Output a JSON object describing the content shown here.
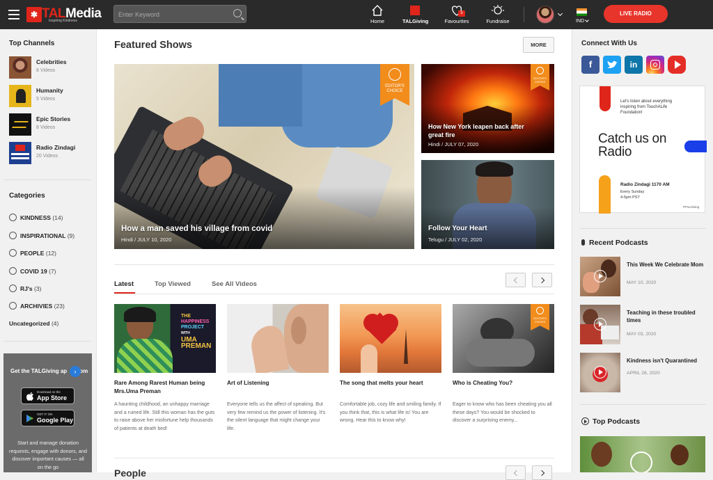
{
  "header": {
    "logo_text_a": "TAL",
    "logo_text_b": "Media",
    "logo_tagline": "Inspiring Kindness",
    "search_placeholder": "Enter Keyword",
    "nav": [
      {
        "label": "Home",
        "icon": "home-icon"
      },
      {
        "label": "TALGiving",
        "icon": "talgiving-icon"
      },
      {
        "label": "Favourites",
        "icon": "heart-icon",
        "badge": "5"
      },
      {
        "label": "Fundraise",
        "icon": "fundraise-icon"
      }
    ],
    "country": "IND",
    "live_radio": "LIVE RADIO"
  },
  "left": {
    "top_channels_title": "Top Channels",
    "channels": [
      {
        "name": "Celebrities",
        "count": "8 Videos"
      },
      {
        "name": "Humanity",
        "count": "5 Videos"
      },
      {
        "name": "Epic Stories",
        "count": "8 Videos"
      },
      {
        "name": "Radio Zindagi",
        "count": "20 Videos"
      }
    ],
    "categories_title": "Categories",
    "categories": [
      {
        "name": "KINDNESS",
        "count": "(14)"
      },
      {
        "name": "INSPIRATIONAL",
        "count": "(9)"
      },
      {
        "name": "PEOPLE",
        "count": "(12)"
      },
      {
        "name": "COVID 19",
        "count": "(7)"
      },
      {
        "name": "RJ's",
        "count": "(3)"
      },
      {
        "name": "ARCHIVIES",
        "count": "(23)"
      },
      {
        "name": "Uncategorized",
        "count": "(4)"
      }
    ],
    "promo": {
      "title": "Get the TALGiving ap",
      "title_tail": "om",
      "app_store_small": "Download on the",
      "app_store_big": "App Store",
      "google_small": "GET IT ON",
      "google_big": "Google Play",
      "desc": "Start and manage donation requests, engage with donors, and discover important causes — all on the go"
    }
  },
  "main": {
    "featured_title": "Featured Shows",
    "more_label": "MORE",
    "editors_choice": "EDITOR'S CHOICE",
    "featured": [
      {
        "title": "How a man saved his village from covid",
        "meta": "Hindi / JULY 10, 2020"
      },
      {
        "title": "How New York leapen back after great fire",
        "meta": "Hindi / JULY 07, 2020"
      },
      {
        "title": "Follow Your Heart",
        "meta": "Telugu / JULY 02, 2020"
      }
    ],
    "tabs": [
      "Latest",
      "Top Viewed",
      "See All Videos"
    ],
    "thumb_text": {
      "a": "THE",
      "b": "HAPPINESS",
      "c": "PROJECT",
      "d": "WITH",
      "e": "UMA",
      "f": "PREMAN"
    },
    "latest": [
      {
        "title": "Rare Among Rarest Human being Mrs.Uma Preman",
        "desc": "A haunting childhood, an unhappy marriage and a ruined life. Still this woman has the guts to raise above her misfortune help thousands of patients at death bed!"
      },
      {
        "title": "Art of Listening",
        "desc": "Everyone tells us the affect of speaking. But very few remind us the power of listening. It's the silent language that might change your life."
      },
      {
        "title": "The song that melts your heart",
        "desc": "Comfortable job, cozy life and smiling family. If you think that, this is what life is! You are wrong. Hear this to know why!"
      },
      {
        "title": "Who is Cheating You?",
        "desc": "Eager to know who has been cheating you all these days? You would be shocked to discover a surprising enemy..."
      }
    ],
    "people_title": "People"
  },
  "right": {
    "connect_title": "Connect With Us",
    "social": [
      "f",
      "t",
      "in",
      "ig",
      "yt"
    ],
    "radio_ad": {
      "lead": "Let's listen about everything inspiring from TouchALife Foundation!",
      "headline_1": "Catch us on",
      "headline_2": "Radio",
      "station": "Radio Zindagi 1170 AM",
      "day": "Every Sunday",
      "time": "4-5pm PST",
      "hashtag": "#TALGiving"
    },
    "recent_title": "Recent Podcasts",
    "podcasts": [
      {
        "title": "This Week We Celebrate Mom",
        "date": "MAY 10, 2020"
      },
      {
        "title": "Teaching in these troubled times",
        "date": "MAY 03, 2020"
      },
      {
        "title": "Kindness isn't Quarantined",
        "date": "APRIL 26, 2020"
      }
    ],
    "top_title": "Top Podcasts"
  }
}
